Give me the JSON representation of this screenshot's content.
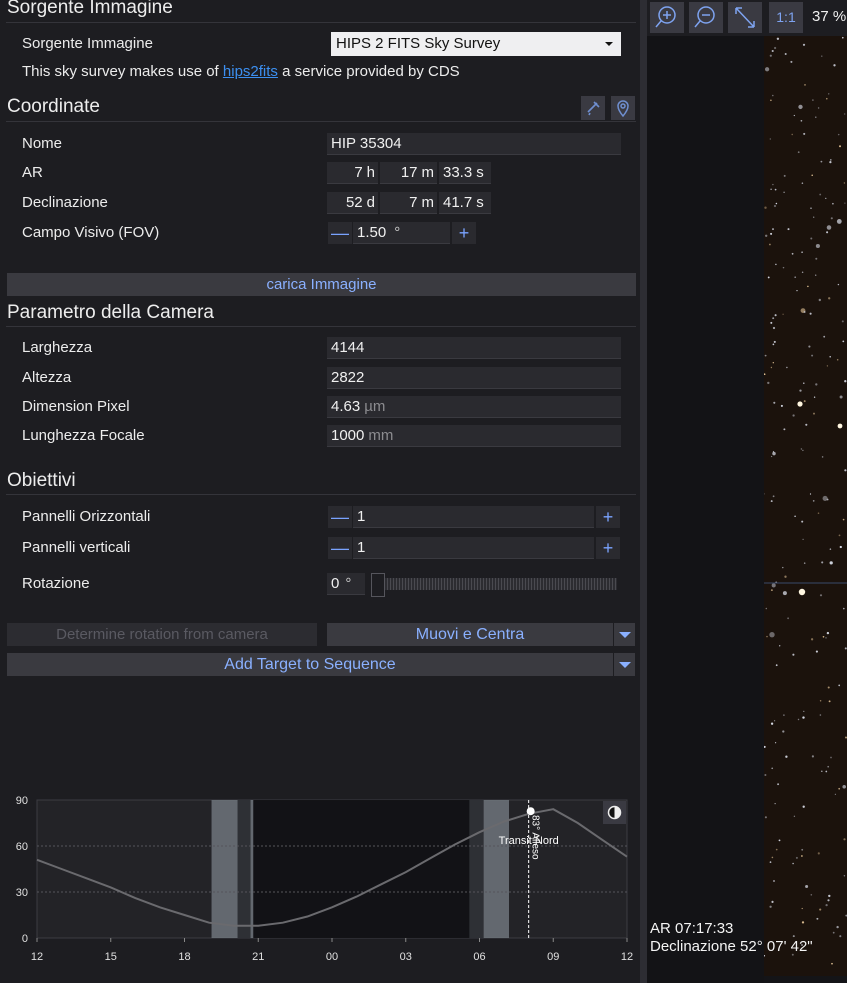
{
  "image_source": {
    "header": "Sorgente Immagine",
    "label": "Sorgente Immagine",
    "selected": "HIPS 2 FITS Sky Survey",
    "credit_prefix": "This sky survey makes use of",
    "credit_link": "hips2fits",
    "credit_suffix": "a service provided by CDS"
  },
  "coordinates": {
    "header": "Coordinate",
    "name_label": "Nome",
    "name_value": "HIP 35304",
    "ra_label": "AR",
    "ra_h": "7",
    "ra_h_unit": "h",
    "ra_m": "17",
    "ra_m_unit": "m",
    "ra_s": "33.3",
    "ra_s_unit": "s",
    "dec_label": "Declinazione",
    "dec_d": "52",
    "dec_d_unit": "d",
    "dec_m": "7",
    "dec_m_unit": "m",
    "dec_s": "41.7",
    "dec_s_unit": "s",
    "fov_label": "Campo Visivo (FOV)",
    "fov_value": "1.50",
    "fov_unit": "°",
    "load_button": "carica Immagine"
  },
  "camera": {
    "header": "Parametro della Camera",
    "width_label": "Larghezza",
    "width_value": "4144",
    "height_label": "Altezza",
    "height_value": "2822",
    "pixel_label": "Dimension Pixel",
    "pixel_value": "4.63",
    "pixel_unit": "µm",
    "focal_label": "Lunghezza Focale",
    "focal_value": "1000",
    "focal_unit": "mm"
  },
  "targets": {
    "header": "Obiettivi",
    "hpanels_label": "Pannelli Orizzontali",
    "hpanels_value": "1",
    "vpanels_label": "Pannelli verticali",
    "vpanels_value": "1",
    "rotation_label": "Rotazione",
    "rotation_value": "0",
    "rotation_unit": "°",
    "rotation_slider_fraction": 0,
    "determine_button": "Determine rotation from camera",
    "move_center_button": "Muovi e Centra",
    "add_target_button": "Add Target to Sequence"
  },
  "viewer": {
    "zoom_level": "37 %",
    "one_to_one": "1:1",
    "ra_readout": "AR 07:17:33",
    "dec_readout": "Declinazione 52° 07' 42\""
  },
  "chart_data": {
    "type": "line",
    "title": "",
    "xlabel": "",
    "ylabel": "",
    "ylim": [
      0,
      90
    ],
    "y_ticks": [
      "0",
      "30",
      "60",
      "90"
    ],
    "x_ticks": [
      "12",
      "15",
      "18",
      "21",
      "00",
      "03",
      "06",
      "09",
      "12"
    ],
    "x_hours": [
      12,
      15,
      18,
      21,
      24,
      27,
      30,
      33,
      36
    ],
    "series": [
      {
        "name": "",
        "x": [
          12,
          13,
          14,
          15,
          16,
          17,
          18,
          19,
          20,
          21,
          22,
          23,
          24,
          25,
          26,
          27,
          28,
          29,
          30,
          31,
          32,
          33,
          34,
          35,
          36
        ],
        "y": [
          51,
          45,
          39,
          33,
          26,
          20,
          15,
          10,
          8,
          8,
          10,
          14,
          20,
          27,
          35,
          43,
          52,
          61,
          69,
          76,
          81,
          84,
          75,
          64,
          53
        ]
      }
    ],
    "night_bands": [
      {
        "from": 19.1,
        "to": 20.8,
        "shade": "twilight"
      },
      {
        "from": 20.8,
        "to": 29.6,
        "shade": "night"
      },
      {
        "from": 29.6,
        "to": 31.2,
        "shade": "twilight"
      }
    ],
    "transit": {
      "x": 32.0,
      "label": "Transit Nord",
      "marker_label": "83° Alleso"
    },
    "colors": {
      "curve": "#6a6a6e",
      "band_twilight": "#7a8088",
      "band_night": "#121215",
      "transit_line": "#ffffff"
    }
  }
}
